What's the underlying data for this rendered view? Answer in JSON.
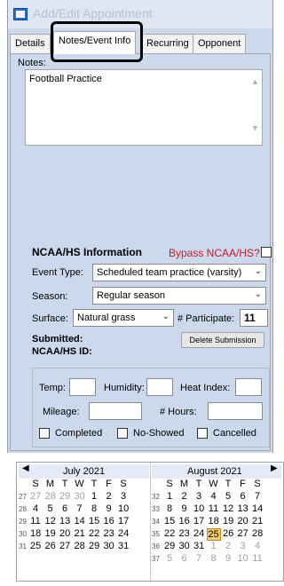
{
  "window": {
    "title": "Add/Edit Appointment"
  },
  "tabs": [
    {
      "label": "Details"
    },
    {
      "label": "Notes/Event Info"
    },
    {
      "label": "Recurring"
    },
    {
      "label": "Opponent"
    }
  ],
  "notes": {
    "label": "Notes:",
    "text": "Football Practice"
  },
  "ncaa": {
    "title": "NCAA/HS Information",
    "bypass_label": "Bypass NCAA/HS?",
    "event_type_label": "Event Type:",
    "event_type_value": "Scheduled team practice (varsity)",
    "season_label": "Season:",
    "season_value": "Regular season",
    "surface_label": "Surface:",
    "surface_value": "Natural grass",
    "participate_label": "# Participate:",
    "participate_value": "11",
    "submitted_label": "Submitted:",
    "ncaa_id_label": "NCAA/HS ID:",
    "delete_button": "Delete Submission"
  },
  "weather": {
    "temp_label": "Temp:",
    "humidity_label": "Humidity:",
    "heat_index_label": "Heat Index:",
    "mileage_label": "Mileage:",
    "hours_label": "# Hours:",
    "completed_label": "Completed",
    "no_showed_label": "No-Showed",
    "cancelled_label": "Cancelled"
  },
  "calendar": {
    "left": {
      "month": "July 2021",
      "dow": [
        "S",
        "M",
        "T",
        "W",
        "T",
        "F",
        "S"
      ],
      "weeks": [
        {
          "wk": "27",
          "days": [
            {
              "d": "27",
              "o": true
            },
            {
              "d": "28",
              "o": true
            },
            {
              "d": "29",
              "o": true
            },
            {
              "d": "30",
              "o": true
            },
            {
              "d": "1"
            },
            {
              "d": "2"
            },
            {
              "d": "3"
            }
          ]
        },
        {
          "wk": "28",
          "days": [
            {
              "d": "4"
            },
            {
              "d": "5"
            },
            {
              "d": "6"
            },
            {
              "d": "7"
            },
            {
              "d": "8"
            },
            {
              "d": "9"
            },
            {
              "d": "10"
            }
          ]
        },
        {
          "wk": "29",
          "days": [
            {
              "d": "11"
            },
            {
              "d": "12"
            },
            {
              "d": "13"
            },
            {
              "d": "14"
            },
            {
              "d": "15"
            },
            {
              "d": "16"
            },
            {
              "d": "17"
            }
          ]
        },
        {
          "wk": "30",
          "days": [
            {
              "d": "18"
            },
            {
              "d": "19"
            },
            {
              "d": "20"
            },
            {
              "d": "21"
            },
            {
              "d": "22"
            },
            {
              "d": "23"
            },
            {
              "d": "24"
            }
          ]
        },
        {
          "wk": "31",
          "days": [
            {
              "d": "25"
            },
            {
              "d": "26"
            },
            {
              "d": "27"
            },
            {
              "d": "28"
            },
            {
              "d": "29"
            },
            {
              "d": "30"
            },
            {
              "d": "31"
            }
          ]
        }
      ]
    },
    "right": {
      "month": "August 2021",
      "dow": [
        "S",
        "M",
        "T",
        "W",
        "T",
        "F",
        "S"
      ],
      "weeks": [
        {
          "wk": "32",
          "days": [
            {
              "d": "1"
            },
            {
              "d": "2"
            },
            {
              "d": "3"
            },
            {
              "d": "4"
            },
            {
              "d": "5"
            },
            {
              "d": "6"
            },
            {
              "d": "7"
            }
          ]
        },
        {
          "wk": "33",
          "days": [
            {
              "d": "8"
            },
            {
              "d": "9"
            },
            {
              "d": "10"
            },
            {
              "d": "11"
            },
            {
              "d": "12"
            },
            {
              "d": "13"
            },
            {
              "d": "14"
            }
          ]
        },
        {
          "wk": "34",
          "days": [
            {
              "d": "15"
            },
            {
              "d": "16"
            },
            {
              "d": "17"
            },
            {
              "d": "18"
            },
            {
              "d": "19"
            },
            {
              "d": "20"
            },
            {
              "d": "21"
            }
          ]
        },
        {
          "wk": "35",
          "days": [
            {
              "d": "22"
            },
            {
              "d": "23"
            },
            {
              "d": "24"
            },
            {
              "d": "25",
              "t": true
            },
            {
              "d": "26"
            },
            {
              "d": "27"
            },
            {
              "d": "28"
            }
          ]
        },
        {
          "wk": "36",
          "days": [
            {
              "d": "29"
            },
            {
              "d": "30"
            },
            {
              "d": "31"
            },
            {
              "d": "1",
              "o": true
            },
            {
              "d": "2",
              "o": true
            },
            {
              "d": "3",
              "o": true
            },
            {
              "d": "4",
              "o": true
            }
          ]
        },
        {
          "wk": "37",
          "days": [
            {
              "d": "5",
              "o": true
            },
            {
              "d": "6",
              "o": true
            },
            {
              "d": "7",
              "o": true
            },
            {
              "d": "8",
              "o": true
            },
            {
              "d": "9",
              "o": true
            },
            {
              "d": "10",
              "o": true
            },
            {
              "d": "11",
              "o": true
            }
          ]
        }
      ]
    }
  }
}
